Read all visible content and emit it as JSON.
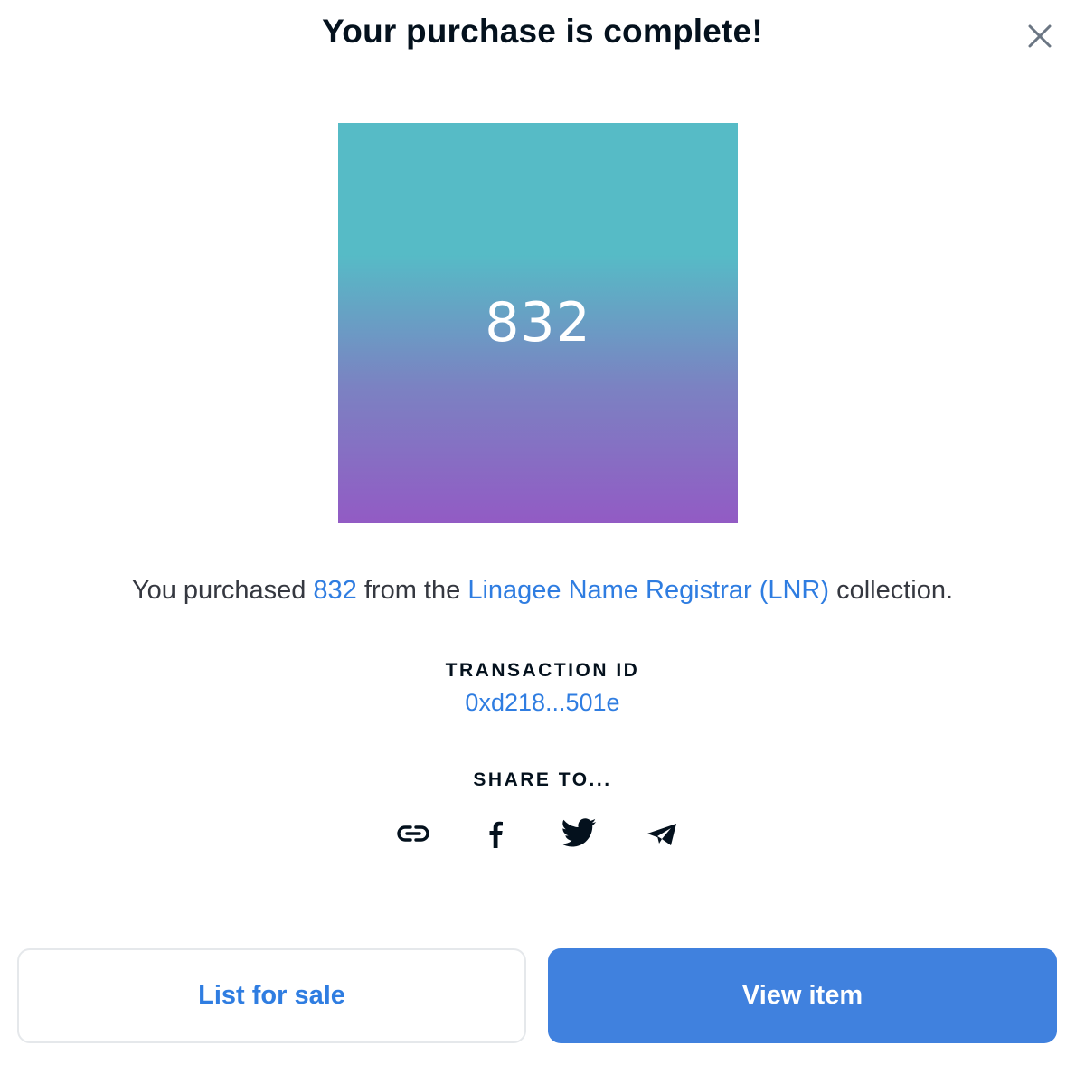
{
  "modal": {
    "title": "Your purchase is complete!",
    "close_icon": "close-icon"
  },
  "nft": {
    "name": "832",
    "gradient_top": "#56bbc6",
    "gradient_bottom": "#925bc4"
  },
  "summary": {
    "prefix": "You purchased ",
    "item": "832",
    "middle": " from the ",
    "collection": "Linagee Name Registrar (LNR)",
    "suffix": " collection."
  },
  "transaction": {
    "label": "TRANSACTION ID",
    "id": "0xd218...501e"
  },
  "share": {
    "label": "SHARE TO...",
    "icons": [
      "link-icon",
      "facebook-icon",
      "twitter-icon",
      "telegram-icon"
    ]
  },
  "actions": {
    "list_for_sale": "List for sale",
    "view_item": "View item"
  },
  "colors": {
    "accent": "#2f7de1",
    "primary_button": "#4081de",
    "text": "#04111d"
  }
}
